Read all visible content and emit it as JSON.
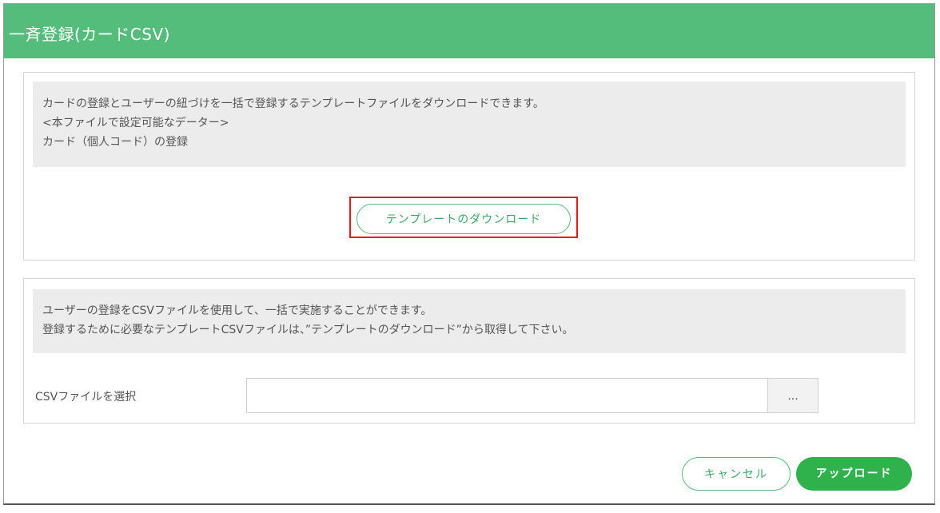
{
  "dialog": {
    "title": "一斉登録(カードCSV)"
  },
  "template_section": {
    "info_lines": [
      "カードの登録とユーザーの紐づけを一括で登録するテンプレートファイルをダウンロードできます。",
      "<本ファイルで設定可能なデーター>",
      "カード（個人コード）の登録"
    ],
    "download_button_label": "テンプレートのダウンロード"
  },
  "upload_section": {
    "info_lines": [
      "ユーザーの登録をCSVファイルを使用して、一括で実施することができます。",
      "登録するために必要なテンプレートCSVファイルは、”テンプレートのダウンロード”から取得して下さい。"
    ],
    "file_label": "CSVファイルを選択",
    "file_value": "",
    "browse_label": "..."
  },
  "footer": {
    "cancel_label": "キャンセル",
    "upload_label": "アップロード"
  },
  "colors": {
    "header_green": "#55bd7b",
    "upload_green": "#2fb24c",
    "highlight_red": "#e0201e"
  }
}
